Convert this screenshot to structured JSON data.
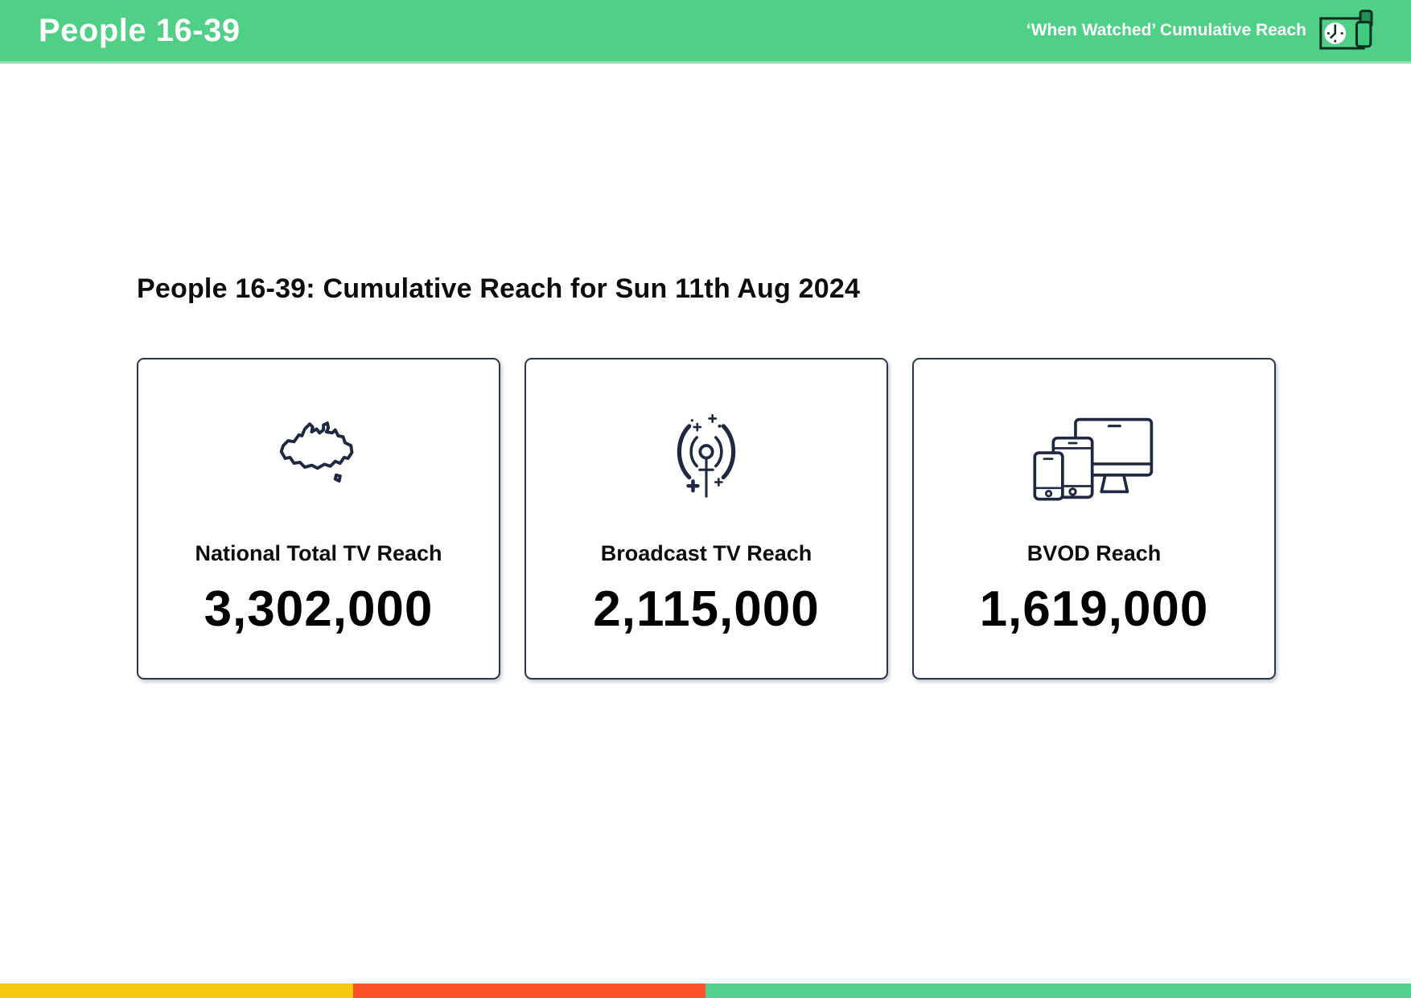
{
  "header": {
    "title": "People 16-39",
    "right_label": "‘When Watched’ Cumulative Reach",
    "bg_color": "#4FD086",
    "bottom_edge_color": "#8FE3B2"
  },
  "main": {
    "heading": "People 16-39: Cumulative Reach for Sun 11th Aug 2024"
  },
  "cards": [
    {
      "icon": "australia-map-icon",
      "label": "National Total TV Reach",
      "value": "3,302,000"
    },
    {
      "icon": "broadcast-antenna-icon",
      "label": "Broadcast TV Reach",
      "value": "2,115,000"
    },
    {
      "icon": "multi-devices-icon",
      "label": "BVOD Reach",
      "value": "1,619,000"
    }
  ],
  "footer_stripe": {
    "segments": [
      {
        "name": "yellow",
        "color": "#F5C80F",
        "width": "25%"
      },
      {
        "name": "red",
        "color": "#FB5126",
        "width": "25%"
      },
      {
        "name": "green",
        "color": "#52D28C",
        "width": "50%"
      }
    ],
    "styles": [
      "background:#F5C80F;width:25%",
      "background:#FB5126;width:25%",
      "background:#52D28C;width:50%"
    ]
  },
  "colors": {
    "icon_stroke_navy": "#1E2840",
    "card_border": "#2A3650",
    "header_icon_stroke": "#0F2E1E",
    "header_icon_phone_fill": "#3ECB7D",
    "header_icon_device_fill": "#1E9553"
  }
}
